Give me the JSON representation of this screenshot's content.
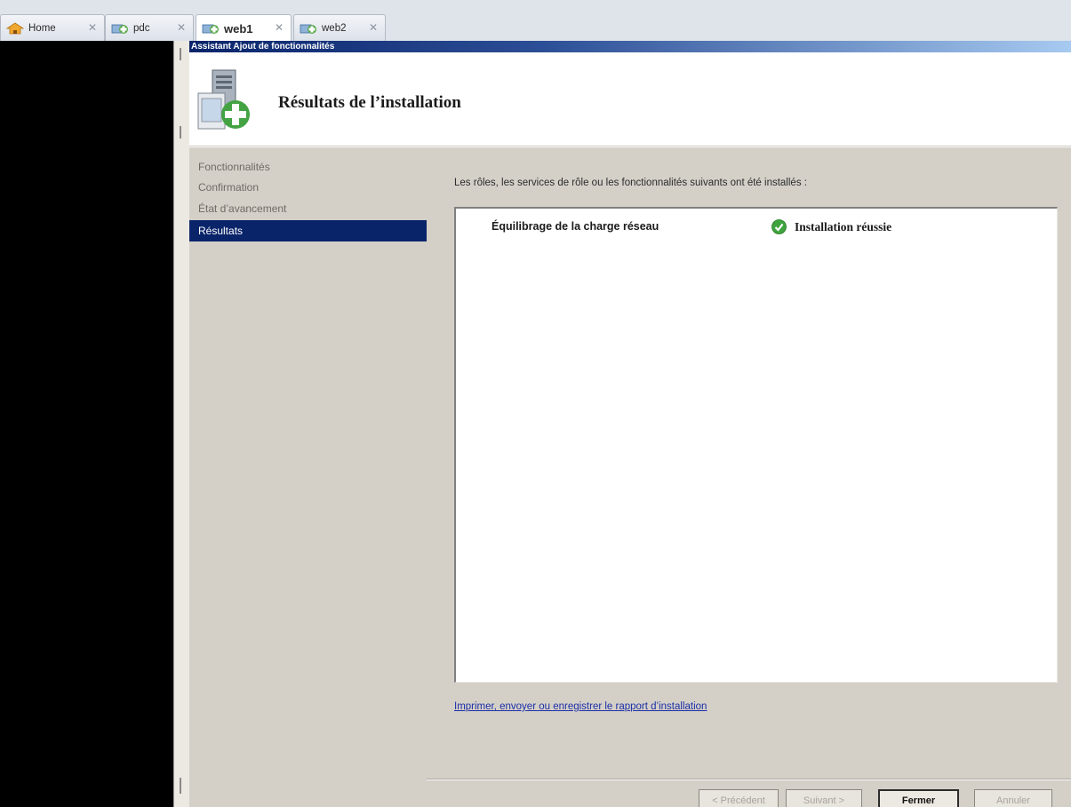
{
  "tabs": [
    {
      "label": "Home",
      "icon": "home-icon",
      "active": false
    },
    {
      "label": "pdc",
      "icon": "vm-icon",
      "active": false
    },
    {
      "label": "web1",
      "icon": "vm-icon",
      "active": true
    },
    {
      "label": "web2",
      "icon": "vm-icon",
      "active": false
    }
  ],
  "tab_close_glyph": "✕",
  "wizard": {
    "window_title": "Assistant Ajout de fonctionnalités",
    "header_title": "Résultats de l’installation",
    "nav": [
      {
        "label": "Fonctionnalités",
        "selected": false
      },
      {
        "label": "Confirmation",
        "selected": false
      },
      {
        "label": "État d’avancement",
        "selected": false
      },
      {
        "label": "Résultats",
        "selected": true
      }
    ],
    "intro_text": "Les rôles, les services de rôle ou les fonctionnalités suivants ont été installés :",
    "results": [
      {
        "name": "Équilibrage de la charge réseau",
        "status": "Installation réussie",
        "status_icon": "success-check-icon"
      }
    ],
    "report_link": "Imprimer, envoyer ou enregistrer le rapport d’installation",
    "buttons": {
      "previous": "< Précédent",
      "next": "Suivant >",
      "close": "Fermer",
      "cancel": "Annuler"
    }
  },
  "colors": {
    "nav_selected": "#0a246a",
    "panel_bg": "#d4d0c8",
    "link": "#1c2fa8",
    "success": "#3ea33e"
  }
}
